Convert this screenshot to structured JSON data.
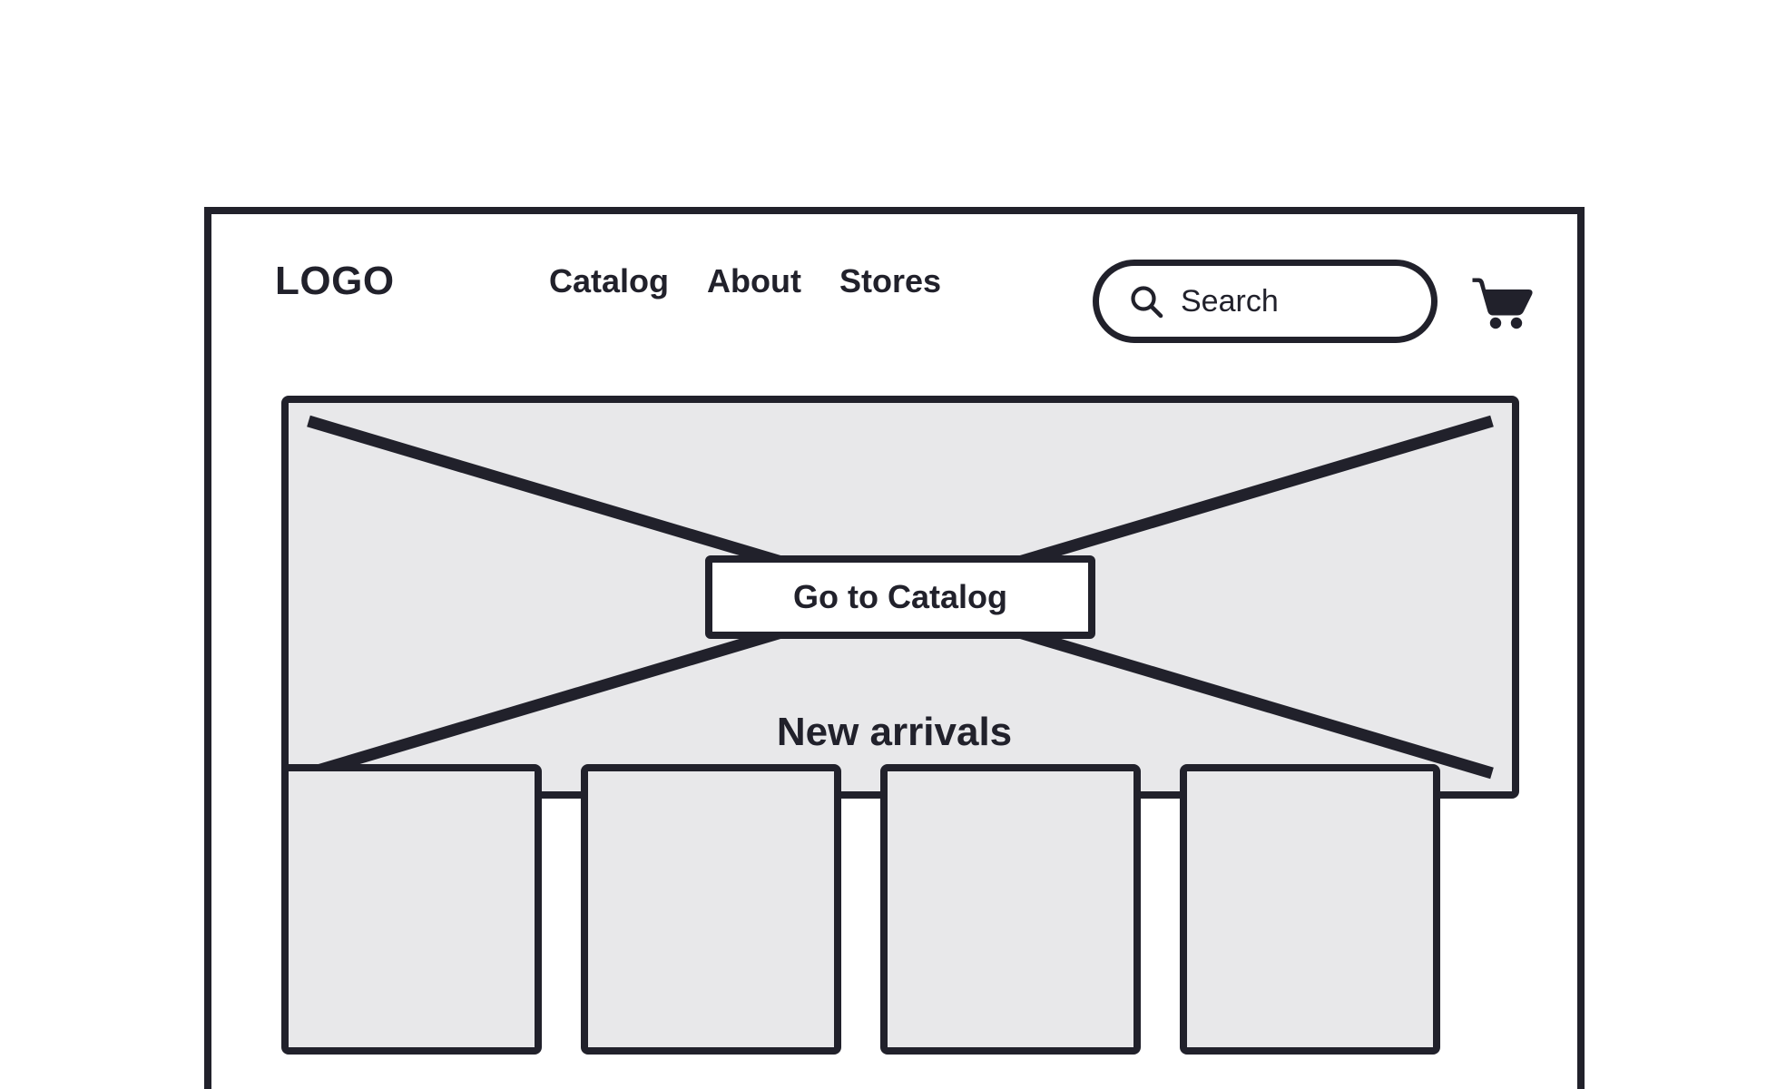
{
  "page": {
    "type": "wireframe-mockup",
    "frame_border_color": "#21212b",
    "placeholder_fill_color": "#e8e8ea",
    "background_color": "#ffffff"
  },
  "header": {
    "logo": "LOGO",
    "nav": [
      {
        "label": "Catalog",
        "name": "nav-link-catalog"
      },
      {
        "label": "About",
        "name": "nav-link-about"
      },
      {
        "label": "Stores",
        "name": "nav-link-stores"
      }
    ],
    "search": {
      "placeholder": "Search",
      "value": "",
      "icon": "search-icon"
    },
    "cart": {
      "icon": "shopping-cart-icon",
      "label": ""
    }
  },
  "hero": {
    "type": "image-placeholder",
    "cta_label": "Go to Catalog"
  },
  "sections": {
    "new_arrivals": {
      "title": "New arrivals",
      "products": [
        {
          "name": "product-card-1"
        },
        {
          "name": "product-card-2"
        },
        {
          "name": "product-card-3"
        },
        {
          "name": "product-card-4"
        }
      ]
    }
  }
}
